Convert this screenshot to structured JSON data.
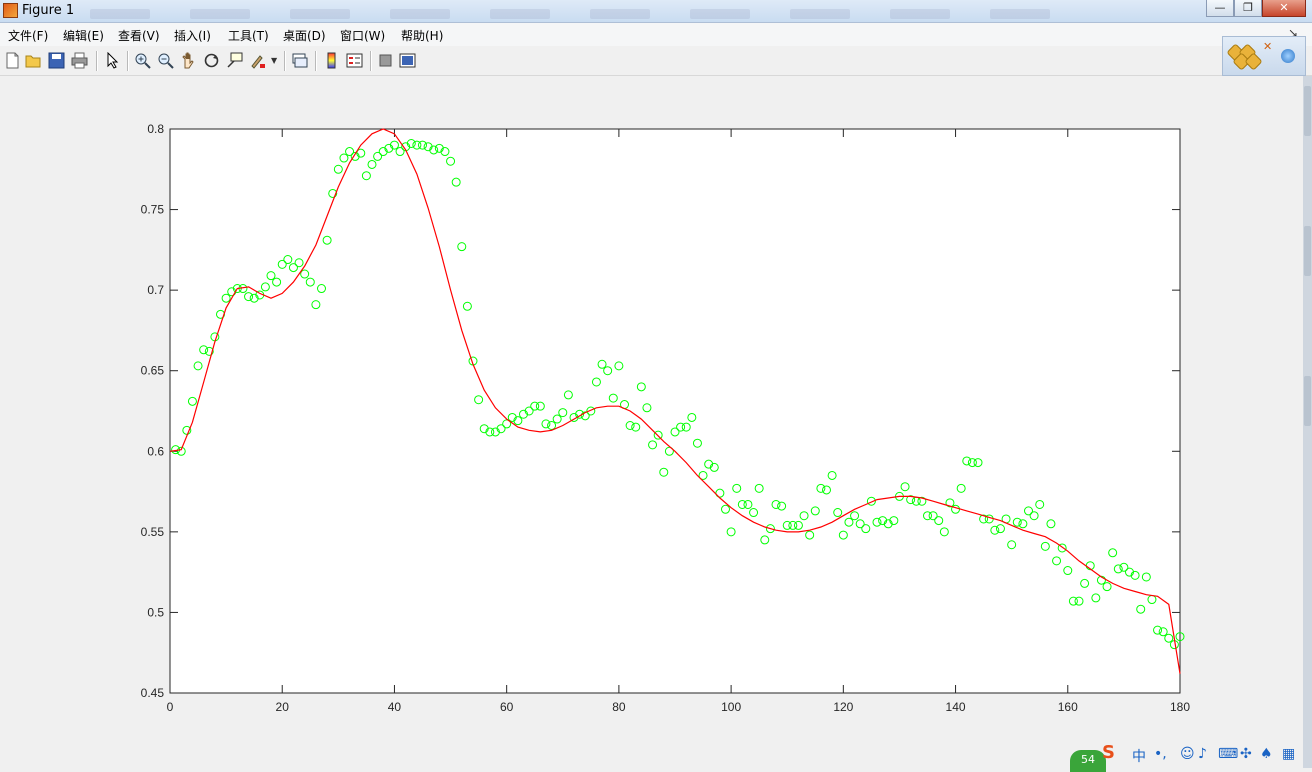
{
  "window": {
    "title": "Figure 1"
  },
  "title_controls": {
    "minimize": "—",
    "maximize": "❐",
    "close": "✕"
  },
  "menu": {
    "items": [
      "文件(F)",
      "编辑(E)",
      "查看(V)",
      "插入(I)",
      "工具(T)",
      "桌面(D)",
      "窗口(W)",
      "帮助(H)"
    ],
    "overflow": "↘"
  },
  "toolbar": {
    "icons": [
      "new-figure-icon",
      "open-file-icon",
      "save-icon",
      "print-icon",
      "pointer-icon",
      "zoom-in-icon",
      "zoom-out-icon",
      "pan-icon",
      "rotate-3d-icon",
      "data-cursor-icon",
      "brush-icon",
      "link-plot-icon",
      "colorbar-icon",
      "legend-icon",
      "hide-plot-tools-icon",
      "show-plot-tools-icon"
    ]
  },
  "taskbar": {
    "badge": "54",
    "ime": "S",
    "lang": "中"
  },
  "colors": {
    "fit_line": "#ff0000",
    "scatter": "#00ff00",
    "axes_bg": "#ffffff",
    "figure_bg": "#f0f0f0"
  },
  "chart_data": {
    "type": "scatter",
    "title": "",
    "xlabel": "",
    "ylabel": "",
    "xlim": [
      0,
      180
    ],
    "ylim": [
      0.45,
      0.8
    ],
    "xticks": [
      0,
      20,
      40,
      60,
      80,
      100,
      120,
      140,
      160,
      180
    ],
    "yticks": [
      "0.45",
      "0.5",
      "0.55",
      "0.6",
      "0.65",
      "0.7",
      "0.75",
      "0.8"
    ],
    "grid": false,
    "legend": "none",
    "series": [
      {
        "kind": "scatter-circles",
        "color": "#00ff00",
        "x": [
          1,
          2,
          3,
          4,
          5,
          6,
          7,
          8,
          9,
          10,
          11,
          12,
          13,
          14,
          15,
          16,
          17,
          18,
          19,
          20,
          21,
          22,
          23,
          24,
          25,
          26,
          27,
          28,
          29,
          30,
          31,
          32,
          33,
          34,
          35,
          36,
          37,
          38,
          39,
          40,
          41,
          42,
          43,
          44,
          45,
          46,
          47,
          48,
          49,
          50,
          51,
          52,
          53,
          54,
          55,
          56,
          57,
          58,
          59,
          60,
          61,
          62,
          63,
          64,
          65,
          66,
          67,
          68,
          69,
          70,
          71,
          72,
          73,
          74,
          75,
          76,
          77,
          78,
          79,
          80,
          81,
          82,
          83,
          84,
          85,
          86,
          87,
          88,
          89,
          90,
          91,
          92,
          93,
          94,
          95,
          96,
          97,
          98,
          99,
          100,
          101,
          102,
          103,
          104,
          105,
          106,
          107,
          108,
          109,
          110,
          111,
          112,
          113,
          114,
          115,
          116,
          117,
          118,
          119,
          120,
          121,
          122,
          123,
          124,
          125,
          126,
          127,
          128,
          129,
          130,
          131,
          132,
          133,
          134,
          135,
          136,
          137,
          138,
          139,
          140,
          141,
          142,
          143,
          144,
          145,
          146,
          147,
          148,
          149,
          150,
          151,
          152,
          153,
          154,
          155,
          156,
          157,
          158,
          159,
          160,
          161,
          162,
          163,
          164,
          165,
          166,
          167,
          168,
          169,
          170,
          171,
          172,
          173,
          174,
          175,
          176,
          177,
          178,
          179,
          180
        ],
        "y": [
          0.601,
          0.6,
          0.613,
          0.631,
          0.653,
          0.663,
          0.662,
          0.671,
          0.685,
          0.695,
          0.699,
          0.701,
          0.701,
          0.696,
          0.695,
          0.697,
          0.702,
          0.709,
          0.705,
          0.716,
          0.719,
          0.714,
          0.717,
          0.71,
          0.705,
          0.691,
          0.701,
          0.731,
          0.76,
          0.775,
          0.782,
          0.786,
          0.783,
          0.785,
          0.771,
          0.778,
          0.783,
          0.786,
          0.788,
          0.79,
          0.786,
          0.789,
          0.791,
          0.79,
          0.79,
          0.789,
          0.787,
          0.788,
          0.786,
          0.78,
          0.767,
          0.727,
          0.69,
          0.656,
          0.632,
          0.614,
          0.612,
          0.612,
          0.614,
          0.617,
          0.621,
          0.619,
          0.623,
          0.625,
          0.628,
          0.628,
          0.617,
          0.616,
          0.62,
          0.624,
          0.635,
          0.621,
          0.623,
          0.622,
          0.625,
          0.643,
          0.654,
          0.65,
          0.633,
          0.653,
          0.629,
          0.616,
          0.615,
          0.64,
          0.627,
          0.604,
          0.61,
          0.587,
          0.6,
          0.612,
          0.615,
          0.615,
          0.621,
          0.605,
          0.585,
          0.592,
          0.59,
          0.574,
          0.564,
          0.55,
          0.577,
          0.567,
          0.567,
          0.562,
          0.577,
          0.545,
          0.552,
          0.567,
          0.566,
          0.554,
          0.554,
          0.554,
          0.56,
          0.548,
          0.563,
          0.577,
          0.576,
          0.585,
          0.562,
          0.548,
          0.556,
          0.56,
          0.555,
          0.552,
          0.569,
          0.556,
          0.557,
          0.555,
          0.557,
          0.572,
          0.578,
          0.57,
          0.569,
          0.569,
          0.56,
          0.56,
          0.557,
          0.55,
          0.568,
          0.564,
          0.577,
          0.594,
          0.593,
          0.593,
          0.558,
          0.558,
          0.551,
          0.552,
          0.558,
          0.542,
          0.556,
          0.555,
          0.563,
          0.56,
          0.567,
          0.541,
          0.555,
          0.532,
          0.54,
          0.526,
          0.507,
          0.507,
          0.518,
          0.529,
          0.509,
          0.52,
          0.516,
          0.537,
          0.527,
          0.528,
          0.525,
          0.523,
          0.502,
          0.522,
          0.508,
          0.489,
          0.488,
          0.484,
          0.48,
          0.485
        ]
      },
      {
        "kind": "fit-line",
        "color": "#ff0000",
        "x": [
          0,
          2,
          4,
          6,
          8,
          10,
          12,
          14,
          16,
          18,
          20,
          22,
          24,
          26,
          28,
          30,
          32,
          34,
          36,
          38,
          40,
          42,
          44,
          46,
          48,
          50,
          52,
          54,
          56,
          58,
          60,
          62,
          64,
          66,
          68,
          70,
          72,
          74,
          76,
          78,
          80,
          82,
          84,
          86,
          88,
          90,
          92,
          94,
          96,
          98,
          100,
          102,
          104,
          106,
          108,
          110,
          112,
          114,
          116,
          118,
          120,
          122,
          124,
          126,
          128,
          130,
          132,
          134,
          136,
          138,
          140,
          142,
          144,
          146,
          148,
          150,
          152,
          154,
          156,
          158,
          160,
          162,
          164,
          166,
          168,
          170,
          172,
          174,
          176,
          178,
          180
        ],
        "y": [
          0.6,
          0.601,
          0.618,
          0.643,
          0.668,
          0.689,
          0.701,
          0.702,
          0.698,
          0.695,
          0.698,
          0.705,
          0.715,
          0.728,
          0.746,
          0.764,
          0.779,
          0.79,
          0.797,
          0.8,
          0.797,
          0.787,
          0.772,
          0.751,
          0.727,
          0.7,
          0.675,
          0.654,
          0.638,
          0.627,
          0.62,
          0.615,
          0.613,
          0.612,
          0.613,
          0.616,
          0.62,
          0.624,
          0.627,
          0.628,
          0.628,
          0.625,
          0.62,
          0.613,
          0.606,
          0.6,
          0.593,
          0.585,
          0.578,
          0.571,
          0.565,
          0.56,
          0.556,
          0.553,
          0.551,
          0.55,
          0.55,
          0.551,
          0.553,
          0.556,
          0.56,
          0.564,
          0.567,
          0.57,
          0.571,
          0.572,
          0.572,
          0.571,
          0.569,
          0.567,
          0.565,
          0.563,
          0.561,
          0.559,
          0.557,
          0.554,
          0.551,
          0.549,
          0.547,
          0.543,
          0.538,
          0.532,
          0.527,
          0.522,
          0.518,
          0.515,
          0.513,
          0.511,
          0.51,
          0.505,
          0.462
        ]
      }
    ]
  }
}
